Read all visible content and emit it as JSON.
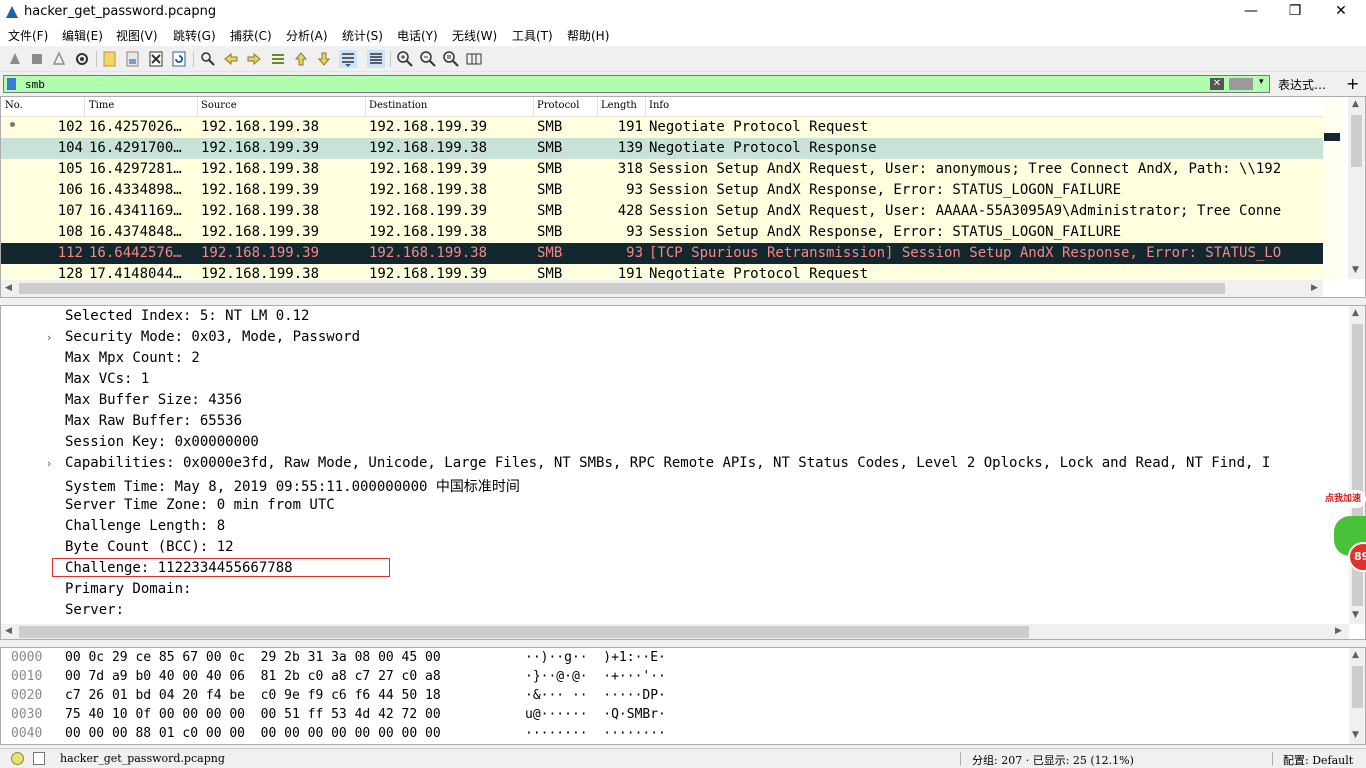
{
  "window": {
    "title": "hacker_get_password.pcapng",
    "minimize": "—",
    "restore": "❐",
    "close": "✕"
  },
  "menu": [
    "文件(F)",
    "编辑(E)",
    "视图(V)",
    "跳转(G)",
    "捕获(C)",
    "分析(A)",
    "统计(S)",
    "电话(Y)",
    "无线(W)",
    "工具(T)",
    "帮助(H)"
  ],
  "toolbar": {
    "icons": [
      "start-capture-icon",
      "stop-capture-icon",
      "restart-capture-icon",
      "capture-options-icon",
      "open-file-icon",
      "save-file-icon",
      "close-file-icon",
      "reload-file-icon",
      "find-packet-icon",
      "go-back-icon",
      "go-forward-icon",
      "go-to-packet-icon",
      "first-packet-icon",
      "last-packet-icon",
      "autoscroll-icon",
      "colorize-icon",
      "zoom-in-icon",
      "zoom-out-icon",
      "normal-size-icon",
      "resize-columns-icon"
    ]
  },
  "filter": {
    "value": "smb",
    "clear": "✕",
    "dropdown": "▾",
    "expression_label": "表达式…",
    "add_label": "+"
  },
  "packet_list": {
    "columns": [
      "No.",
      "Time",
      "Source",
      "Destination",
      "Protocol",
      "Length",
      "Info"
    ],
    "rows": [
      {
        "no": "102",
        "time": "16.4257026…",
        "src": "192.168.199.38",
        "dst": "192.168.199.39",
        "proto": "SMB",
        "len": "191",
        "info": "Negotiate Protocol Request",
        "style": "request"
      },
      {
        "no": "104",
        "time": "16.4291700…",
        "src": "192.168.199.39",
        "dst": "192.168.199.38",
        "proto": "SMB",
        "len": "139",
        "info": "Negotiate Protocol Response",
        "style": "selected"
      },
      {
        "no": "105",
        "time": "16.4297281…",
        "src": "192.168.199.38",
        "dst": "192.168.199.39",
        "proto": "SMB",
        "len": "318",
        "info": "Session Setup AndX Request, User: anonymous; Tree Connect AndX, Path: \\\\192",
        "style": "request"
      },
      {
        "no": "106",
        "time": "16.4334898…",
        "src": "192.168.199.39",
        "dst": "192.168.199.38",
        "proto": "SMB",
        "len": "93",
        "info": "Session Setup AndX Response, Error: STATUS_LOGON_FAILURE",
        "style": "request"
      },
      {
        "no": "107",
        "time": "16.4341169…",
        "src": "192.168.199.38",
        "dst": "192.168.199.39",
        "proto": "SMB",
        "len": "428",
        "info": "Session Setup AndX Request, User: AAAAA-55A3095A9\\Administrator; Tree Conne",
        "style": "request"
      },
      {
        "no": "108",
        "time": "16.4374848…",
        "src": "192.168.199.39",
        "dst": "192.168.199.38",
        "proto": "SMB",
        "len": "93",
        "info": "Session Setup AndX Response, Error: STATUS_LOGON_FAILURE",
        "style": "request"
      },
      {
        "no": "112",
        "time": "16.6442576…",
        "src": "192.168.199.39",
        "dst": "192.168.199.38",
        "proto": "SMB",
        "len": "93",
        "info": "[TCP Spurious Retransmission] Session Setup AndX Response, Error: STATUS_LO",
        "style": "error"
      },
      {
        "no": "128",
        "time": "17.4148044…",
        "src": "192.168.199.38",
        "dst": "192.168.199.39",
        "proto": "SMB",
        "len": "191",
        "info": "Negotiate Protocol Request",
        "style": "request"
      }
    ]
  },
  "details": {
    "lines": [
      {
        "text": "Selected Index: 5: NT LM 0.12",
        "expandable": false
      },
      {
        "text": "Security Mode: 0x03, Mode, Password",
        "expandable": true
      },
      {
        "text": "Max Mpx Count: 2",
        "expandable": false
      },
      {
        "text": "Max VCs: 1",
        "expandable": false
      },
      {
        "text": "Max Buffer Size: 4356",
        "expandable": false
      },
      {
        "text": "Max Raw Buffer: 65536",
        "expandable": false
      },
      {
        "text": "Session Key: 0x00000000",
        "expandable": false
      },
      {
        "text": "Capabilities: 0x0000e3fd, Raw Mode, Unicode, Large Files, NT SMBs, RPC Remote APIs, NT Status Codes, Level 2 Oplocks, Lock and Read, NT Find, I",
        "expandable": true
      },
      {
        "text": "System Time: May  8, 2019 09:55:11.000000000 中国标准时间",
        "expandable": false
      },
      {
        "text": "Server Time Zone: 0 min from UTC",
        "expandable": false
      },
      {
        "text": "Challenge Length: 8",
        "expandable": false
      },
      {
        "text": "Byte Count (BCC): 12",
        "expandable": false
      },
      {
        "text": "Challenge: 1122334455667788",
        "expandable": false
      },
      {
        "text": "Primary Domain:",
        "expandable": false
      },
      {
        "text": "Server:",
        "expandable": false
      }
    ]
  },
  "bytes": {
    "lines": [
      {
        "offset": "0000",
        "hex": "00 0c 29 ce 85 67 00 0c  29 2b 31 3a 08 00 45 00",
        "ascii": "··)··g··  )+1:··E·"
      },
      {
        "offset": "0010",
        "hex": "00 7d a9 b0 40 00 40 06  81 2b c0 a8 c7 27 c0 a8",
        "ascii": "·}··@·@·  ·+···'··"
      },
      {
        "offset": "0020",
        "hex": "c7 26 01 bd 04 20 f4 be  c0 9e f9 c6 f6 44 50 18",
        "ascii": "·&··· ··  ·····DP·"
      },
      {
        "offset": "0030",
        "hex": "75 40 10 0f 00 00 00 00  00 51 ff 53 4d 42 72 00",
        "ascii": "u@······  ·Q·SMBr·"
      },
      {
        "offset": "0040",
        "hex": "00 00 00 88 01 c0 00 00  00 00 00 00 00 00 00 00",
        "ascii": "········  ········"
      }
    ]
  },
  "status": {
    "file": "hacker_get_password.pcapng",
    "stats": "分组: 207 · 已显示: 25 (12.1%)",
    "profile": "配置: Default"
  },
  "overlay": {
    "label": "点我加速",
    "badge": "89"
  },
  "colors": {
    "row_request": "#ffffe0",
    "row_response": "#c8e2d8",
    "row_error_bg": "#12272e",
    "row_error_fg": "#f78787",
    "filter_ok": "#afffaf",
    "highlight_box": "#e03030"
  }
}
